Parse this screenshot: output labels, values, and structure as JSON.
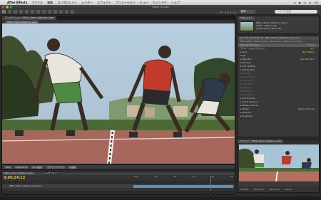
{
  "menubar": {
    "app_name": "After Effects",
    "items": [
      "ファイル",
      "編集",
      "コンポジション",
      "レイヤー",
      "エフェクト",
      "アニメーション",
      "ビュー",
      "ウィンドウ",
      "ヘルプ"
    ],
    "right_items": [
      "A",
      "◉",
      "◷",
      "🔊",
      "AE"
    ]
  },
  "window": {
    "title": "Toon4_v2.aep"
  },
  "toolbar": {
    "workspace_label": "ワークスペース:",
    "workspace_value": "標準",
    "search_placeholder": "ヘルプを検索"
  },
  "composition": {
    "tab_label": "コンポジション: 0801_sharer_distance_vase",
    "sub_tab_label": "0801_sharer_distance_vase",
    "footer": {
      "zoom": "50%",
      "time": "0;00;24;12",
      "resolution": "(1/2 画質)",
      "camera": "アクティブカメラ",
      "view": "1 画面"
    }
  },
  "project": {
    "tab_label": "プロジェクト",
    "info_line1": "0801_sharer_distance_vase ▾",
    "info_line2": "1920 x 1080 (1.00)",
    "info_line3": "Δ 0;00;16;16, 29.97 fps"
  },
  "effect_controls": {
    "tab_label": "エフェクトコントロール: 0801_sharer_distance_vase.mov",
    "sub_label": "0801_sharer_distance_vase • 0801_sharer_distance_vase.mov",
    "rows": [
      {
        "label": "▾ Toonit Sony Tone",
        "value": "リセット",
        "state": "hl"
      },
      {
        "label": "アニメーションプリセット:",
        "value": "なし",
        "state": ""
      },
      {
        "label": "▸ Auto",
        "value": "Not Shaded",
        "state": ""
      },
      {
        "label": "Lines",
        "value": "",
        "state": ""
      },
      {
        "label": "▸ Main Blur",
        "value": "Use Main Blur",
        "state": ""
      },
      {
        "label": "▸ Shading",
        "value": "",
        "state": ""
      },
      {
        "label": "▸ Color Effects",
        "value": "",
        "state": ""
      },
      {
        "label": "▸ Flat Shaded",
        "value": "",
        "state": ""
      },
      {
        "label": "▸ Flat Blur",
        "value": "",
        "state": "dim"
      },
      {
        "label": "▸ Smoothness",
        "value": "",
        "state": "dim"
      },
      {
        "label": "▸ Edge Color",
        "value": "",
        "state": "dim"
      },
      {
        "label": "▸ Line Width",
        "value": "",
        "state": "dim"
      },
      {
        "label": "▸ Contrast",
        "value": "",
        "state": "dim"
      },
      {
        "label": "▸ Brightness",
        "value": "",
        "state": "dim"
      },
      {
        "label": "▸ Saturation",
        "value": "",
        "state": "dim"
      },
      {
        "label": "▸ Soft Outlines",
        "value": "",
        "state": ""
      },
      {
        "label": "▸ Comic Outlines",
        "value": "",
        "state": ""
      },
      {
        "label": "▸ Marker Outlines",
        "value": "",
        "state": ""
      },
      {
        "label": "▸ Marker",
        "value": "Marker Outlines",
        "state": ""
      },
      {
        "label": "  ▸ Distance",
        "value": "",
        "state": ""
      },
      {
        "label": "  ▸ Simplicity",
        "value": "",
        "state": ""
      }
    ]
  },
  "preview": {
    "tab_label": "プレビュー: 0801_sharer_distance_vase",
    "ruler": [
      "0;00;16f",
      "0;00;24;12",
      "0;00;34;12",
      "0;00;40"
    ]
  },
  "timeline": {
    "tabs": [
      "0801_sharer_distance_vase",
      "レンダーキュー"
    ],
    "current_time": "0;00;24;12",
    "layer_name": "0801_sharer_distance_vase.mov",
    "ruler": [
      "0:00s",
      "05s",
      "10s",
      "15s",
      "20s",
      "25s"
    ]
  }
}
